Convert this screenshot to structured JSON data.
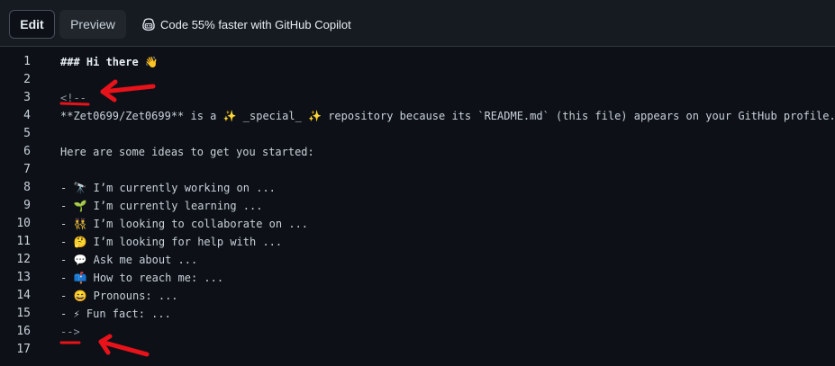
{
  "tabs": [
    {
      "label": "Edit",
      "active": true
    },
    {
      "label": "Preview",
      "active": false
    }
  ],
  "copilot": {
    "text": "Code 55% faster with GitHub Copilot",
    "icon": "copilot-icon"
  },
  "editor": {
    "lines": [
      {
        "num": "1",
        "text": "### Hi there 👋",
        "style": "heading"
      },
      {
        "num": "2",
        "text": "",
        "style": "normal"
      },
      {
        "num": "3",
        "text": "<!--",
        "style": "comment"
      },
      {
        "num": "4",
        "text": "**Zet0699/Zet0699** is a ✨ _special_ ✨ repository because its `README.md` (this file) appears on your GitHub profile.",
        "style": "normal"
      },
      {
        "num": "5",
        "text": "",
        "style": "normal"
      },
      {
        "num": "6",
        "text": "Here are some ideas to get you started:",
        "style": "normal"
      },
      {
        "num": "7",
        "text": "",
        "style": "normal"
      },
      {
        "num": "8",
        "text": "- 🔭 I’m currently working on ...",
        "style": "normal"
      },
      {
        "num": "9",
        "text": "- 🌱 I’m currently learning ...",
        "style": "normal"
      },
      {
        "num": "10",
        "text": "- 👯 I’m looking to collaborate on ...",
        "style": "normal"
      },
      {
        "num": "11",
        "text": "- 🤔 I’m looking for help with ...",
        "style": "normal"
      },
      {
        "num": "12",
        "text": "- 💬 Ask me about ...",
        "style": "normal"
      },
      {
        "num": "13",
        "text": "- 📫 How to reach me: ...",
        "style": "normal"
      },
      {
        "num": "14",
        "text": "- 😄 Pronouns: ...",
        "style": "normal"
      },
      {
        "num": "15",
        "text": "- ⚡ Fun fact: ...",
        "style": "normal"
      },
      {
        "num": "16",
        "text": "-->",
        "style": "comment"
      },
      {
        "num": "17",
        "text": "",
        "style": "normal"
      }
    ]
  },
  "colors": {
    "background": "#0d1117",
    "toolbar": "#161b22",
    "annotation": "#e8121a"
  }
}
